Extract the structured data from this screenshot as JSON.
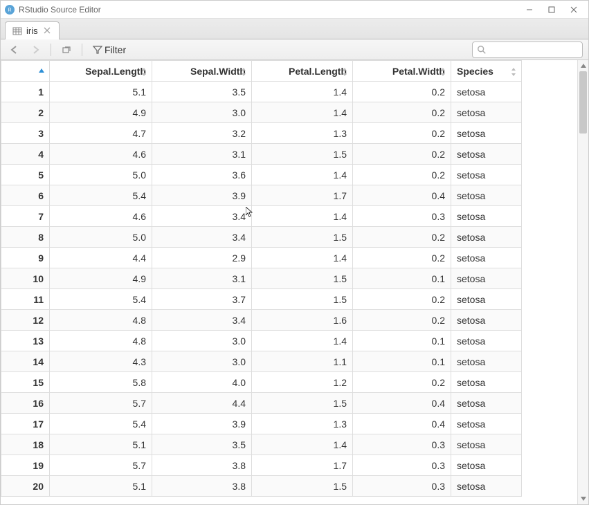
{
  "window": {
    "title": "RStudio Source Editor"
  },
  "tab": {
    "name": "iris"
  },
  "toolbar": {
    "filter_label": "Filter",
    "search_placeholder": ""
  },
  "columns": [
    "Sepal.Length",
    "Sepal.Width",
    "Petal.Length",
    "Petal.Width",
    "Species"
  ],
  "rows": [
    {
      "n": 1,
      "sl": "5.1",
      "sw": "3.5",
      "pl": "1.4",
      "pw": "0.2",
      "sp": "setosa"
    },
    {
      "n": 2,
      "sl": "4.9",
      "sw": "3.0",
      "pl": "1.4",
      "pw": "0.2",
      "sp": "setosa"
    },
    {
      "n": 3,
      "sl": "4.7",
      "sw": "3.2",
      "pl": "1.3",
      "pw": "0.2",
      "sp": "setosa"
    },
    {
      "n": 4,
      "sl": "4.6",
      "sw": "3.1",
      "pl": "1.5",
      "pw": "0.2",
      "sp": "setosa"
    },
    {
      "n": 5,
      "sl": "5.0",
      "sw": "3.6",
      "pl": "1.4",
      "pw": "0.2",
      "sp": "setosa"
    },
    {
      "n": 6,
      "sl": "5.4",
      "sw": "3.9",
      "pl": "1.7",
      "pw": "0.4",
      "sp": "setosa"
    },
    {
      "n": 7,
      "sl": "4.6",
      "sw": "3.4",
      "pl": "1.4",
      "pw": "0.3",
      "sp": "setosa"
    },
    {
      "n": 8,
      "sl": "5.0",
      "sw": "3.4",
      "pl": "1.5",
      "pw": "0.2",
      "sp": "setosa"
    },
    {
      "n": 9,
      "sl": "4.4",
      "sw": "2.9",
      "pl": "1.4",
      "pw": "0.2",
      "sp": "setosa"
    },
    {
      "n": 10,
      "sl": "4.9",
      "sw": "3.1",
      "pl": "1.5",
      "pw": "0.1",
      "sp": "setosa"
    },
    {
      "n": 11,
      "sl": "5.4",
      "sw": "3.7",
      "pl": "1.5",
      "pw": "0.2",
      "sp": "setosa"
    },
    {
      "n": 12,
      "sl": "4.8",
      "sw": "3.4",
      "pl": "1.6",
      "pw": "0.2",
      "sp": "setosa"
    },
    {
      "n": 13,
      "sl": "4.8",
      "sw": "3.0",
      "pl": "1.4",
      "pw": "0.1",
      "sp": "setosa"
    },
    {
      "n": 14,
      "sl": "4.3",
      "sw": "3.0",
      "pl": "1.1",
      "pw": "0.1",
      "sp": "setosa"
    },
    {
      "n": 15,
      "sl": "5.8",
      "sw": "4.0",
      "pl": "1.2",
      "pw": "0.2",
      "sp": "setosa"
    },
    {
      "n": 16,
      "sl": "5.7",
      "sw": "4.4",
      "pl": "1.5",
      "pw": "0.4",
      "sp": "setosa"
    },
    {
      "n": 17,
      "sl": "5.4",
      "sw": "3.9",
      "pl": "1.3",
      "pw": "0.4",
      "sp": "setosa"
    },
    {
      "n": 18,
      "sl": "5.1",
      "sw": "3.5",
      "pl": "1.4",
      "pw": "0.3",
      "sp": "setosa"
    },
    {
      "n": 19,
      "sl": "5.7",
      "sw": "3.8",
      "pl": "1.7",
      "pw": "0.3",
      "sp": "setosa"
    },
    {
      "n": 20,
      "sl": "5.1",
      "sw": "3.8",
      "pl": "1.5",
      "pw": "0.3",
      "sp": "setosa"
    }
  ]
}
